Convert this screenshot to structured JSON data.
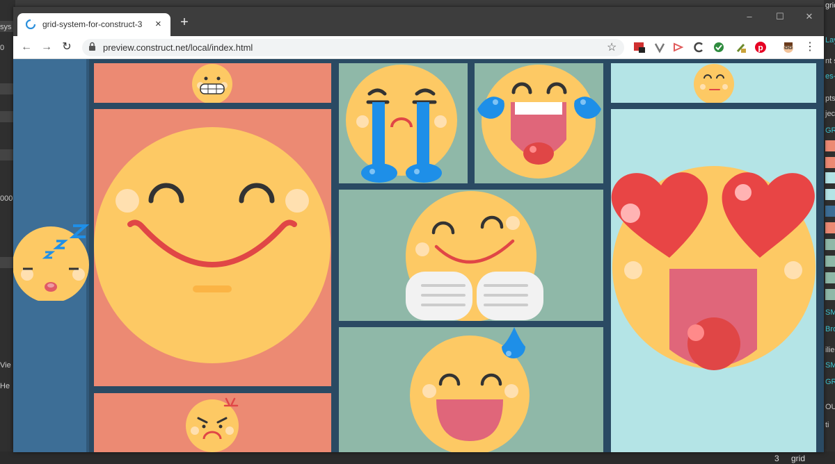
{
  "browser": {
    "tab_title": "grid-system-for-construct-3",
    "new_tab_label": "+",
    "url": "preview.construct.net/local/index.html",
    "tab_close_label": "×",
    "minimize_label": "–",
    "maximize_label": "☐",
    "close_label": "✕",
    "back_label": "←",
    "forward_label": "→",
    "reload_label": "↻",
    "star_label": "☆",
    "menu_label": "⋮"
  },
  "background_app": {
    "left_texts": [
      "sys",
      "0",
      "000",
      "Vie",
      "He"
    ],
    "right_texts": [
      "grid-syste",
      "Lay",
      "nt s",
      "es-",
      "pts",
      "ject",
      "GR",
      "SM",
      "Bro",
      "ilie",
      "SM",
      "GR",
      "OUT",
      "ti"
    ],
    "bottom_number": "3",
    "bottom_label": "grid"
  },
  "colors": {
    "sidebar": "#3d6e96",
    "grid_bg": "#2a4a63",
    "salmon": "#ec8a73",
    "sage": "#8fb8a8",
    "light_cyan": "#b4e4e6",
    "emoji_yellow": "#fdc964",
    "emoji_dark": "#fbb445",
    "cheek": "#ffe0b0",
    "mouth_red": "#e04646",
    "tear_blue": "#1e8fe8"
  },
  "cells": [
    {
      "name": "grin-teeth",
      "color": "salmon",
      "emoji": "grinning-teeth-emoji"
    },
    {
      "name": "big-smile",
      "color": "salmon",
      "emoji": "happy-smile-emoji"
    },
    {
      "name": "angry",
      "color": "salmon",
      "emoji": "angry-emoji"
    },
    {
      "name": "crying",
      "color": "sage",
      "emoji": "crying-emoji"
    },
    {
      "name": "laugh-tears",
      "color": "sage",
      "emoji": "laughing-tears-emoji"
    },
    {
      "name": "hug",
      "color": "sage",
      "emoji": "hugging-emoji"
    },
    {
      "name": "sweat-smile",
      "color": "sage",
      "emoji": "sweat-smile-emoji"
    },
    {
      "name": "smirk",
      "color": "light_cyan",
      "emoji": "smirk-emoji"
    },
    {
      "name": "heart-eyes",
      "color": "light_cyan",
      "emoji": "heart-eyes-emoji"
    },
    {
      "name": "sleeping",
      "color": "sidebar",
      "emoji": "sleeping-emoji"
    }
  ]
}
